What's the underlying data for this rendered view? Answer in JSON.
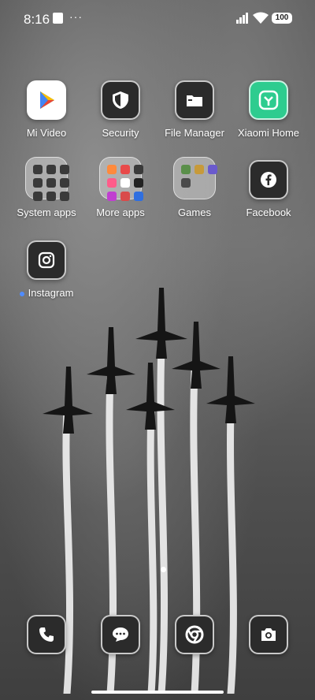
{
  "status_bar": {
    "time": "8:16",
    "more": "···",
    "battery_percent": "100"
  },
  "apps": [
    {
      "label": "Mi Video",
      "icon": "play-icon"
    },
    {
      "label": "Security",
      "icon": "shield-icon"
    },
    {
      "label": "File Manager",
      "icon": "folder-icon"
    },
    {
      "label": "Xiaomi Home",
      "icon": "mi-home-icon"
    },
    {
      "label": "System apps",
      "icon": "folder-grid-icon"
    },
    {
      "label": "More apps",
      "icon": "folder-grid-icon"
    },
    {
      "label": "Games",
      "icon": "folder-grid-icon"
    },
    {
      "label": "Facebook",
      "icon": "facebook-icon"
    },
    {
      "label": "Instagram",
      "icon": "instagram-icon"
    }
  ],
  "dock": [
    {
      "icon": "phone-icon"
    },
    {
      "icon": "messages-icon"
    },
    {
      "icon": "chrome-icon"
    },
    {
      "icon": "camera-icon"
    }
  ],
  "colors": {
    "accent_blue": "#4f8cff",
    "mi_home_green": "#2ecc8f"
  }
}
